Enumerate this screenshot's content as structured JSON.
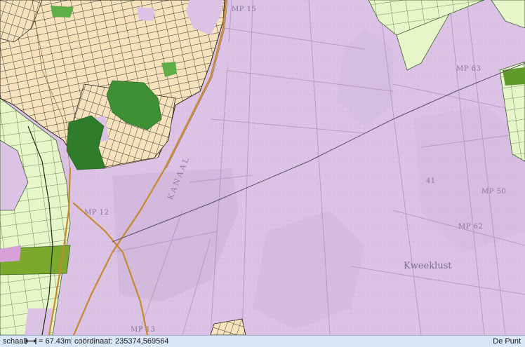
{
  "map": {
    "labels": {
      "mp15": "MP 15",
      "mp63": "MP 63",
      "mp50": "MP 50",
      "mp62": "MP 62",
      "mp12": "MP 12",
      "mp13": "MP 13",
      "kanaal": "KANAAL",
      "kweeklust": "Kweeklust",
      "num41": "41"
    },
    "colors": {
      "land": "#dcc3e6",
      "parcel": "#f6e3be",
      "forest_dark": "#3f8f35",
      "forest_mid": "#5fae48",
      "agri_light": "#e6f6c8",
      "agri_green": "#86b83a",
      "road": "#c8892e",
      "line": "#5b4f68"
    }
  },
  "statusbar": {
    "scale_label": "schaal:",
    "scale_value": "= 67.43m",
    "coord_label": "coördinaat:",
    "coord_value": "235374,569564",
    "location": "De Punt"
  }
}
